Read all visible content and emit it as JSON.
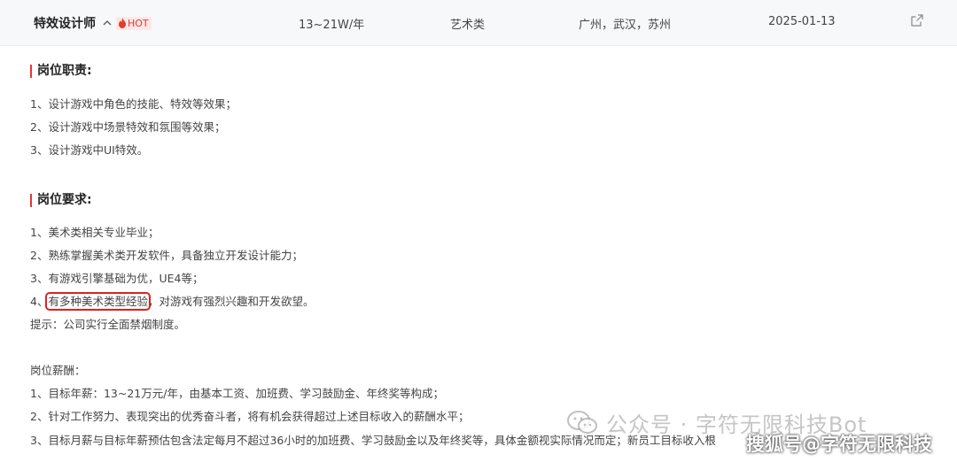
{
  "job": {
    "title": "特效设计师",
    "hot_label": "HOT",
    "salary": "13~21W/年",
    "category": "艺术类",
    "locations": "广州，武汉，苏州",
    "date": "2025-01-13"
  },
  "duties": {
    "heading": "岗位职责:",
    "items": [
      "1、设计游戏中角色的技能、特效等效果；",
      "2、设计游戏中场景特效和氛围等效果；",
      "3、设计游戏中UI特效。"
    ]
  },
  "requirements": {
    "heading": "岗位要求:",
    "items": [
      "1、美术类相关专业毕业；",
      "2、熟练掌握美术类开发软件，具备独立开发设计能力；",
      "3、有游戏引擎基础为优，UE4等；"
    ],
    "item4_prefix": "4、",
    "item4_highlight": "有多种美术类型经验",
    "item4_rest": "，对游戏有强烈兴趣和开发欲望。",
    "note": "提示：公司实行全面禁烟制度。"
  },
  "compensation": {
    "heading": "岗位薪酬：",
    "items": [
      "1、目标年薪：13~21万元/年，由基本工资、加班费、学习鼓励金、年终奖等构成；",
      "2、针对工作努力、表现突出的优秀奋斗者，将有机会获得超过上述目标收入的薪酬水平；",
      "3、目标月薪与目标年薪预估包含法定每月不超过36小时的加班费、学习鼓励金以及年终奖等，具体金额视实际情况而定；新员工目标收入根"
    ]
  },
  "watermarks": {
    "wechat": "公众号 · 字符无限科技Bot",
    "sohu": "搜狐号@字符无限科技"
  },
  "icons": {
    "collapse": "chevron-up-icon",
    "hot": "flame-icon",
    "external": "external-link-icon",
    "wechat": "wechat-logo-icon"
  },
  "colors": {
    "accent": "#e23b2e",
    "highlight_box": "#e02020",
    "header_bg": "#f7f8fa"
  }
}
